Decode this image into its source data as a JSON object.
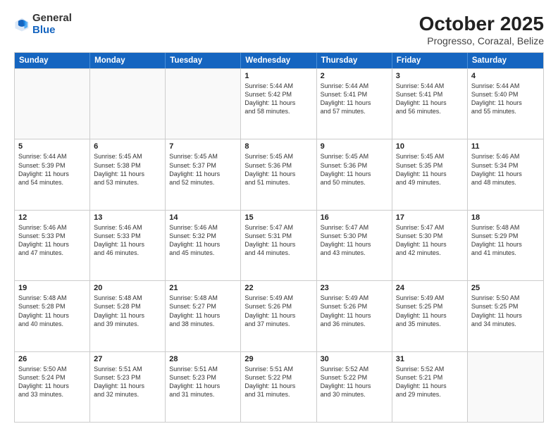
{
  "logo": {
    "general": "General",
    "blue": "Blue"
  },
  "title": "October 2025",
  "location": "Progresso, Corazal, Belize",
  "days_of_week": [
    "Sunday",
    "Monday",
    "Tuesday",
    "Wednesday",
    "Thursday",
    "Friday",
    "Saturday"
  ],
  "weeks": [
    [
      {
        "day": "",
        "content": ""
      },
      {
        "day": "",
        "content": ""
      },
      {
        "day": "",
        "content": ""
      },
      {
        "day": "1",
        "content": "Sunrise: 5:44 AM\nSunset: 5:42 PM\nDaylight: 11 hours\nand 58 minutes."
      },
      {
        "day": "2",
        "content": "Sunrise: 5:44 AM\nSunset: 5:41 PM\nDaylight: 11 hours\nand 57 minutes."
      },
      {
        "day": "3",
        "content": "Sunrise: 5:44 AM\nSunset: 5:41 PM\nDaylight: 11 hours\nand 56 minutes."
      },
      {
        "day": "4",
        "content": "Sunrise: 5:44 AM\nSunset: 5:40 PM\nDaylight: 11 hours\nand 55 minutes."
      }
    ],
    [
      {
        "day": "5",
        "content": "Sunrise: 5:44 AM\nSunset: 5:39 PM\nDaylight: 11 hours\nand 54 minutes."
      },
      {
        "day": "6",
        "content": "Sunrise: 5:45 AM\nSunset: 5:38 PM\nDaylight: 11 hours\nand 53 minutes."
      },
      {
        "day": "7",
        "content": "Sunrise: 5:45 AM\nSunset: 5:37 PM\nDaylight: 11 hours\nand 52 minutes."
      },
      {
        "day": "8",
        "content": "Sunrise: 5:45 AM\nSunset: 5:36 PM\nDaylight: 11 hours\nand 51 minutes."
      },
      {
        "day": "9",
        "content": "Sunrise: 5:45 AM\nSunset: 5:36 PM\nDaylight: 11 hours\nand 50 minutes."
      },
      {
        "day": "10",
        "content": "Sunrise: 5:45 AM\nSunset: 5:35 PM\nDaylight: 11 hours\nand 49 minutes."
      },
      {
        "day": "11",
        "content": "Sunrise: 5:46 AM\nSunset: 5:34 PM\nDaylight: 11 hours\nand 48 minutes."
      }
    ],
    [
      {
        "day": "12",
        "content": "Sunrise: 5:46 AM\nSunset: 5:33 PM\nDaylight: 11 hours\nand 47 minutes."
      },
      {
        "day": "13",
        "content": "Sunrise: 5:46 AM\nSunset: 5:33 PM\nDaylight: 11 hours\nand 46 minutes."
      },
      {
        "day": "14",
        "content": "Sunrise: 5:46 AM\nSunset: 5:32 PM\nDaylight: 11 hours\nand 45 minutes."
      },
      {
        "day": "15",
        "content": "Sunrise: 5:47 AM\nSunset: 5:31 PM\nDaylight: 11 hours\nand 44 minutes."
      },
      {
        "day": "16",
        "content": "Sunrise: 5:47 AM\nSunset: 5:30 PM\nDaylight: 11 hours\nand 43 minutes."
      },
      {
        "day": "17",
        "content": "Sunrise: 5:47 AM\nSunset: 5:30 PM\nDaylight: 11 hours\nand 42 minutes."
      },
      {
        "day": "18",
        "content": "Sunrise: 5:48 AM\nSunset: 5:29 PM\nDaylight: 11 hours\nand 41 minutes."
      }
    ],
    [
      {
        "day": "19",
        "content": "Sunrise: 5:48 AM\nSunset: 5:28 PM\nDaylight: 11 hours\nand 40 minutes."
      },
      {
        "day": "20",
        "content": "Sunrise: 5:48 AM\nSunset: 5:28 PM\nDaylight: 11 hours\nand 39 minutes."
      },
      {
        "day": "21",
        "content": "Sunrise: 5:48 AM\nSunset: 5:27 PM\nDaylight: 11 hours\nand 38 minutes."
      },
      {
        "day": "22",
        "content": "Sunrise: 5:49 AM\nSunset: 5:26 PM\nDaylight: 11 hours\nand 37 minutes."
      },
      {
        "day": "23",
        "content": "Sunrise: 5:49 AM\nSunset: 5:26 PM\nDaylight: 11 hours\nand 36 minutes."
      },
      {
        "day": "24",
        "content": "Sunrise: 5:49 AM\nSunset: 5:25 PM\nDaylight: 11 hours\nand 35 minutes."
      },
      {
        "day": "25",
        "content": "Sunrise: 5:50 AM\nSunset: 5:25 PM\nDaylight: 11 hours\nand 34 minutes."
      }
    ],
    [
      {
        "day": "26",
        "content": "Sunrise: 5:50 AM\nSunset: 5:24 PM\nDaylight: 11 hours\nand 33 minutes."
      },
      {
        "day": "27",
        "content": "Sunrise: 5:51 AM\nSunset: 5:23 PM\nDaylight: 11 hours\nand 32 minutes."
      },
      {
        "day": "28",
        "content": "Sunrise: 5:51 AM\nSunset: 5:23 PM\nDaylight: 11 hours\nand 31 minutes."
      },
      {
        "day": "29",
        "content": "Sunrise: 5:51 AM\nSunset: 5:22 PM\nDaylight: 11 hours\nand 31 minutes."
      },
      {
        "day": "30",
        "content": "Sunrise: 5:52 AM\nSunset: 5:22 PM\nDaylight: 11 hours\nand 30 minutes."
      },
      {
        "day": "31",
        "content": "Sunrise: 5:52 AM\nSunset: 5:21 PM\nDaylight: 11 hours\nand 29 minutes."
      },
      {
        "day": "",
        "content": ""
      }
    ]
  ]
}
